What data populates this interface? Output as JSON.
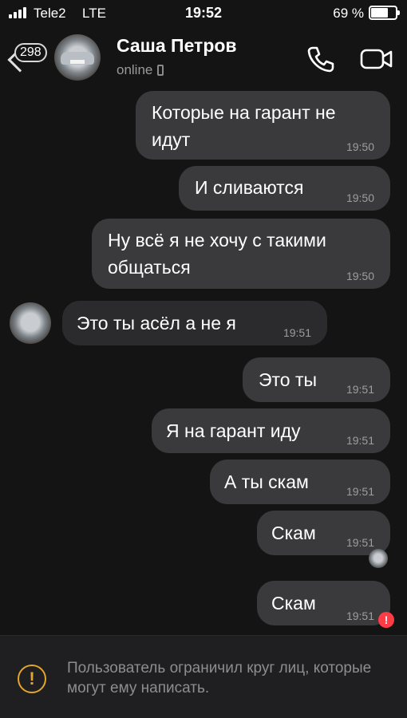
{
  "status_bar": {
    "carrier": "Tele2",
    "network": "LTE",
    "time": "19:52",
    "battery_percent": "69 %",
    "battery_level": 0.69
  },
  "header": {
    "unread_count": "298",
    "contact_name": "Саша Петров",
    "contact_status": "online",
    "icons": [
      "back-chevron-icon",
      "phone-icon",
      "video-camera-icon"
    ]
  },
  "messages": [
    {
      "direction": "out",
      "text": "Которые на гарант не идут",
      "time": "19:50"
    },
    {
      "direction": "out",
      "text": "И сливаются",
      "time": "19:50"
    },
    {
      "direction": "out",
      "text": "Ну всё я не хочу с такими общаться",
      "time": "19:50"
    },
    {
      "direction": "in",
      "text": "Это ты асёл а не я",
      "time": "19:51"
    },
    {
      "direction": "out",
      "text": "Это ты",
      "time": "19:51"
    },
    {
      "direction": "out",
      "text": "Я на гарант иду",
      "time": "19:51"
    },
    {
      "direction": "out",
      "text": "А ты скам",
      "time": "19:51"
    },
    {
      "direction": "out",
      "text": "Скам",
      "time": "19:51",
      "read": true
    },
    {
      "direction": "out",
      "text": "Скам",
      "time": "19:51",
      "failed": true,
      "failed_mark": "!"
    }
  ],
  "notice": {
    "icon": "!",
    "text": "Пользователь ограничил круг лиц, которые могут ему написать."
  },
  "colors": {
    "background": "#141414",
    "outgoing_bubble": "#3a3a3c",
    "incoming_bubble": "#2b2b2d",
    "warning": "#e3a62a",
    "error": "#ff3b45"
  }
}
